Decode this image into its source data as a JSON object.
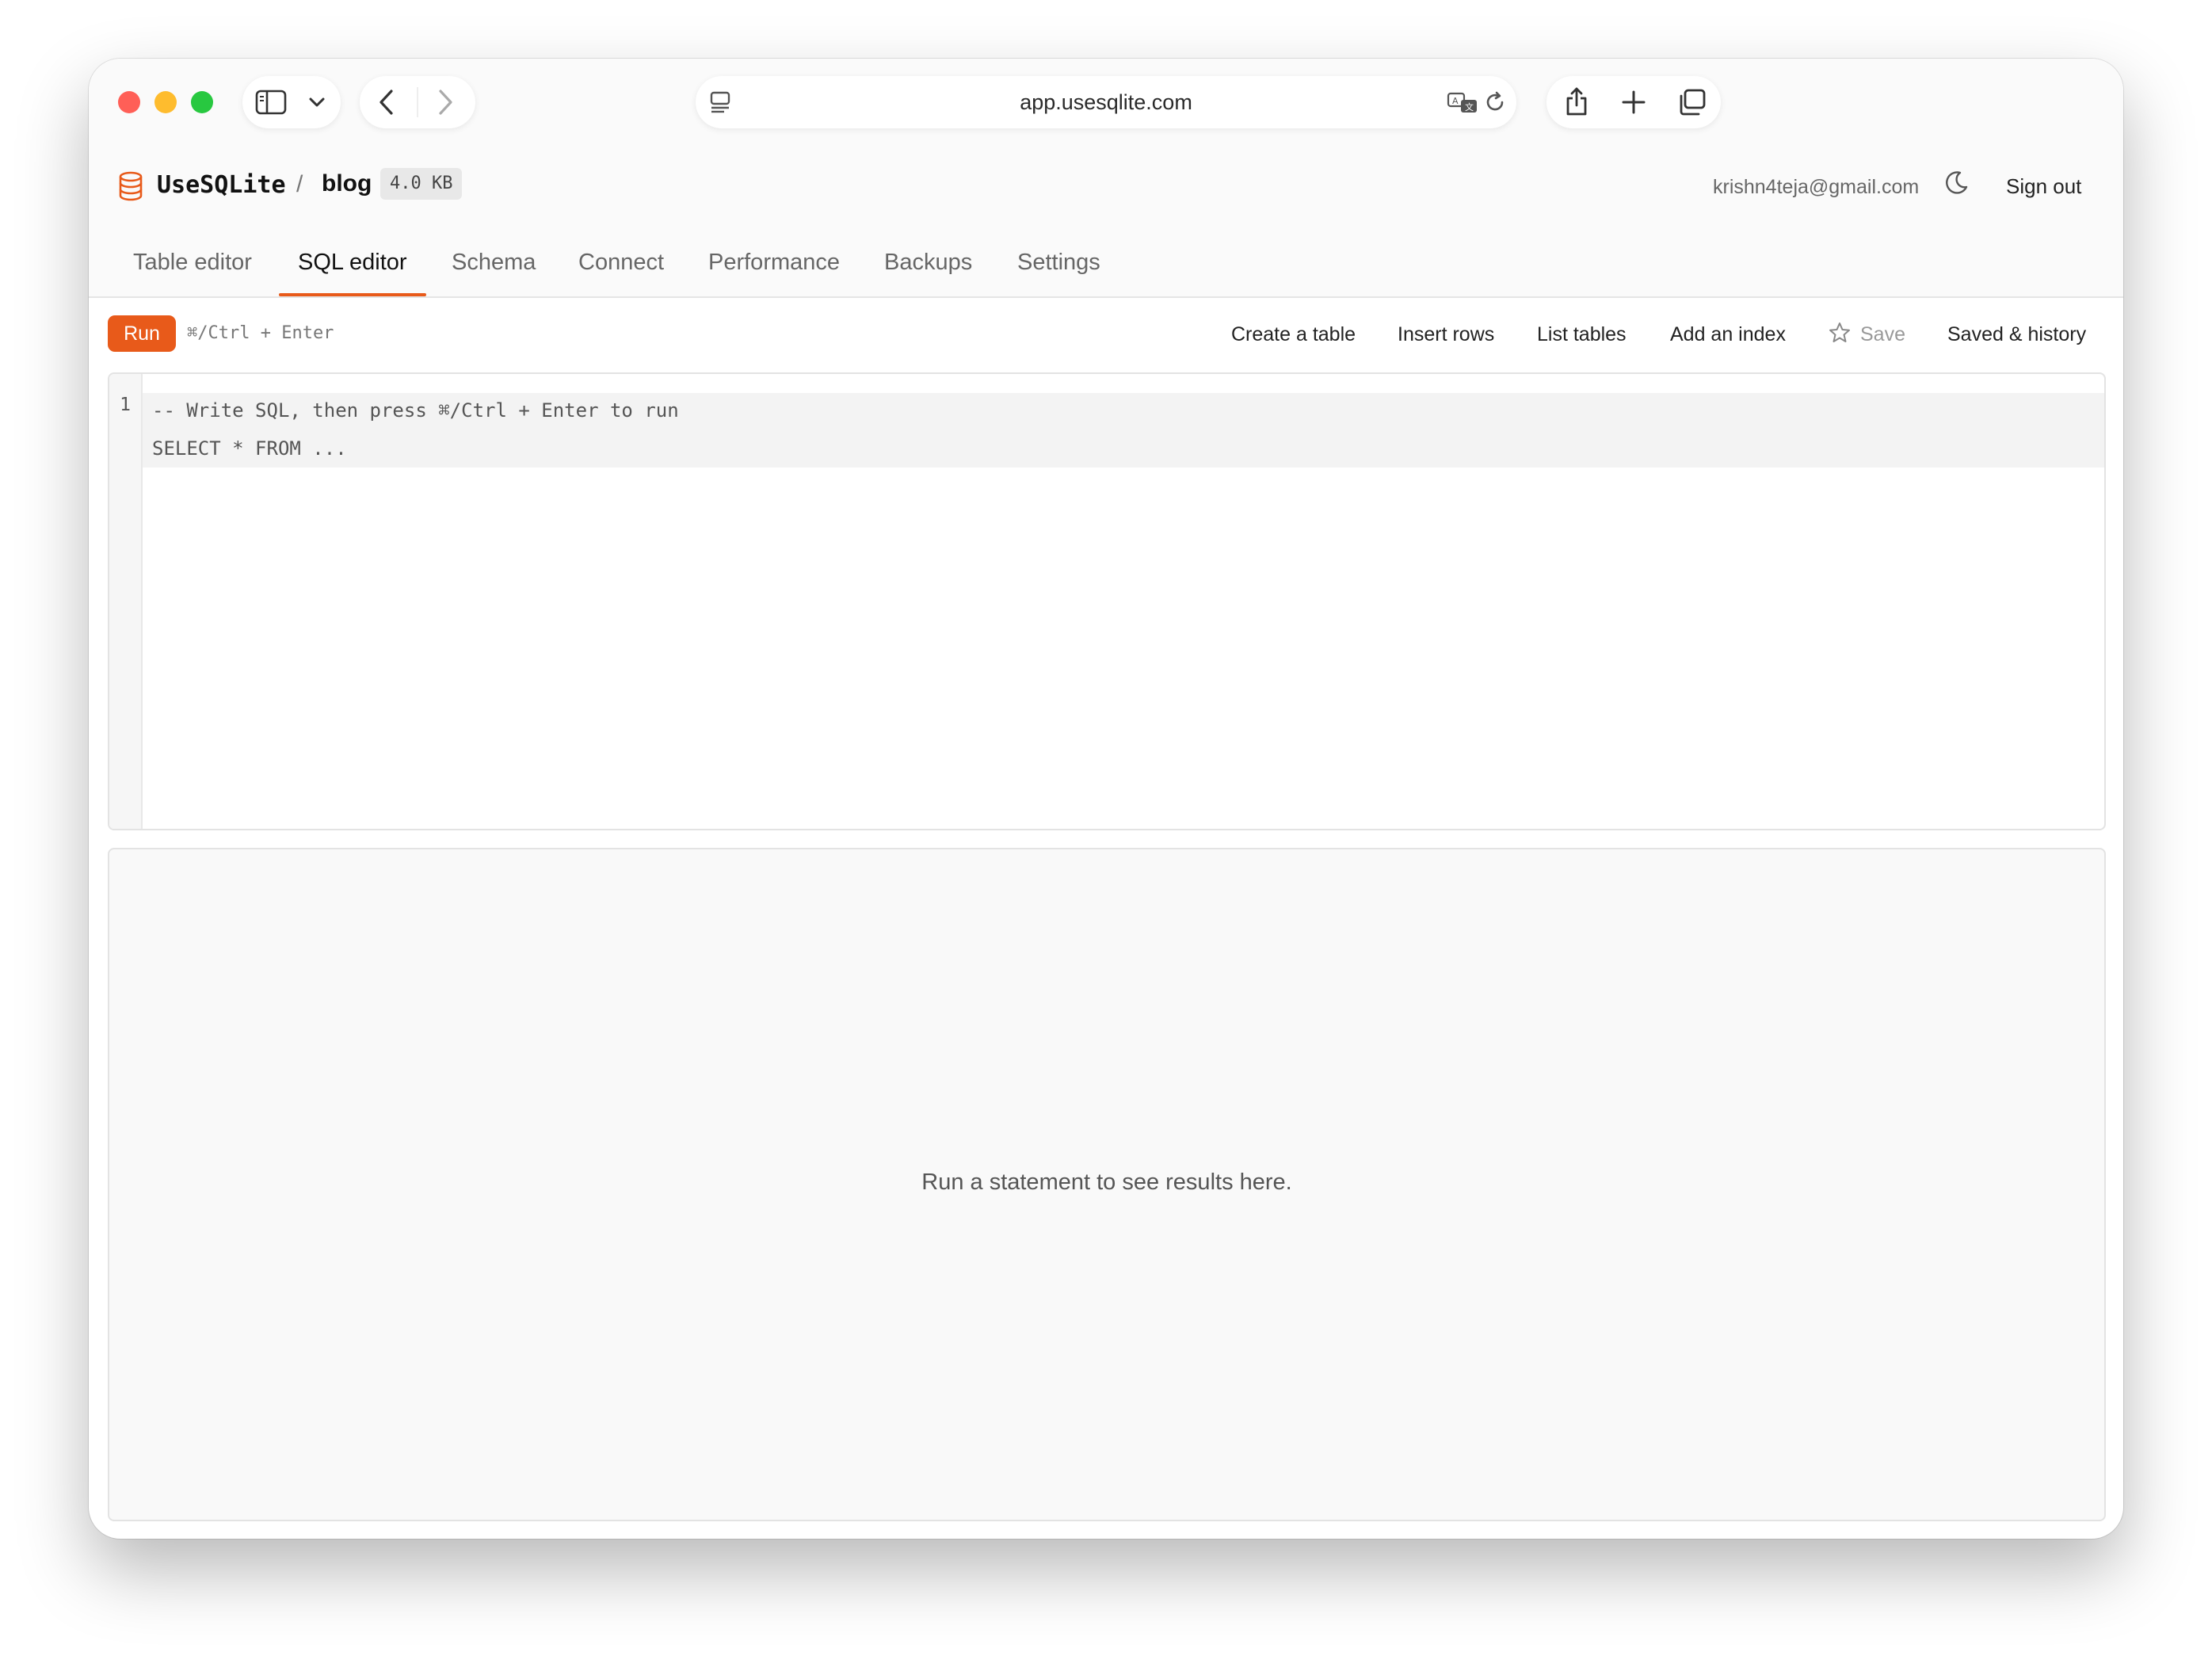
{
  "browser": {
    "url": "app.usesqlite.com",
    "icons": [
      "sidebar-toggle-icon",
      "chevron-down-icon",
      "back-arrow-icon",
      "forward-arrow-icon",
      "page-menu-icon",
      "translate-icon",
      "reload-icon",
      "share-icon",
      "new-tab-icon",
      "tabs-overview-icon"
    ]
  },
  "header": {
    "brand": "UseSQLite",
    "separator": "/",
    "database": "blog",
    "database_size": "4.0 KB",
    "user_email": "krishn4teja@gmail.com",
    "sign_out": "Sign out",
    "accent_color": "#e85a1a"
  },
  "tabs": [
    {
      "label": "Table editor"
    },
    {
      "label": "SQL editor",
      "active": true
    },
    {
      "label": "Schema"
    },
    {
      "label": "Connect"
    },
    {
      "label": "Performance"
    },
    {
      "label": "Backups"
    },
    {
      "label": "Settings"
    }
  ],
  "toolbar": {
    "run_label": "Run",
    "run_hint": "⌘/Ctrl + Enter",
    "create_table": "Create a table",
    "insert_rows": "Insert rows",
    "list_tables": "List tables",
    "add_index": "Add an index",
    "save": "Save",
    "saved_history": "Saved & history"
  },
  "editor": {
    "line_number": "1",
    "lines": [
      "-- Write SQL, then press ⌘/Ctrl + Enter to run",
      "SELECT * FROM ..."
    ]
  },
  "results": {
    "empty_message": "Run a statement to see results here."
  }
}
